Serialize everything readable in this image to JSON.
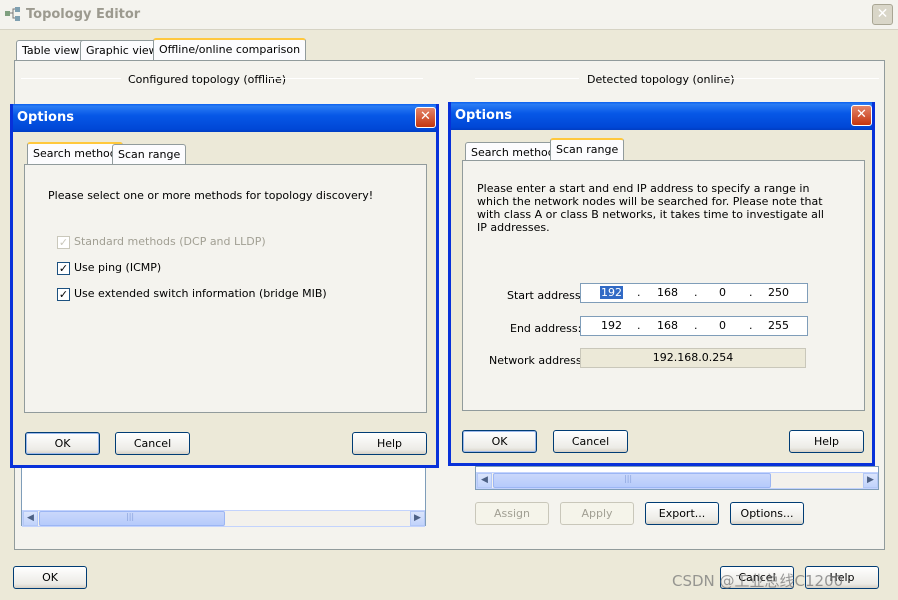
{
  "main": {
    "title": "Topology Editor",
    "close_glyph": "✕",
    "tabs": [
      {
        "label": "Table view"
      },
      {
        "label": "Graphic view"
      },
      {
        "label": "Offline/online comparison"
      }
    ],
    "offline_heading": "Configured topology (offline)",
    "online_heading": "Detected topology (online)",
    "buttons": {
      "assign": "Assign",
      "apply": "Apply",
      "export": "Export...",
      "options": "Options...",
      "ok": "OK",
      "cancel": "Cancel",
      "help": "Help"
    },
    "watermark": "CSDN @工业总线C1200"
  },
  "dialog_left": {
    "title": "Options",
    "close_glyph": "✕",
    "tabs": [
      {
        "label": "Search method"
      },
      {
        "label": "Scan range"
      }
    ],
    "instruction": "Please select one or more methods for topology discovery!",
    "options": [
      {
        "label": "Standard methods (DCP and LLDP)",
        "checked": true,
        "disabled": true
      },
      {
        "label": "Use ping (ICMP)",
        "checked": true,
        "disabled": false
      },
      {
        "label": "Use extended switch information (bridge MIB)",
        "checked": true,
        "disabled": false
      }
    ],
    "check_glyph": "✓",
    "buttons": {
      "ok": "OK",
      "cancel": "Cancel",
      "help": "Help"
    }
  },
  "dialog_right": {
    "title": "Options",
    "close_glyph": "✕",
    "tabs": [
      {
        "label": "Search method"
      },
      {
        "label": "Scan range"
      }
    ],
    "description": "Please enter a start and end IP address to specify a range in which the network nodes will be searched for. Please note that with class A or class B networks, it takes time to investigate all IP addresses.",
    "start_label": "Start address:",
    "end_label": "End address:",
    "network_label": "Network address:",
    "start_octets": [
      "192",
      "168",
      "0",
      "250"
    ],
    "end_octets": [
      "192",
      "168",
      "0",
      "255"
    ],
    "dot": ".",
    "network_address": "192.168.0.254",
    "buttons": {
      "ok": "OK",
      "cancel": "Cancel",
      "help": "Help"
    }
  },
  "icons": {
    "scroll_left": "◀",
    "scroll_right": "▶",
    "grip": "|||"
  }
}
